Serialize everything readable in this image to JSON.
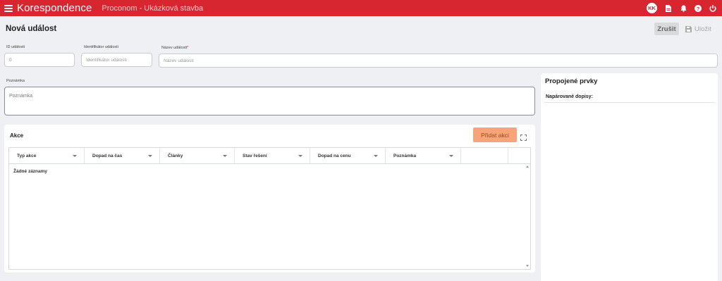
{
  "app": {
    "title": "Korespondence",
    "project": "Proconom - Ukázková stavba",
    "avatar_initials": "KK",
    "accent_color": "#d7262f",
    "icons": [
      "menu-icon",
      "document-icon",
      "bell-icon",
      "help-icon",
      "logout-icon"
    ]
  },
  "page": {
    "title": "Nová událost",
    "cancel_label": "Zrušit",
    "save_label": "Uložit"
  },
  "form": {
    "id_label": "ID události",
    "id_value": "0",
    "identifier_label": "Identifikátor události",
    "identifier_placeholder": "Identifikátor události",
    "name_label": "Název události",
    "name_placeholder": "Název události",
    "note_label": "Poznámka",
    "note_placeholder": "Poznámka"
  },
  "akce": {
    "title": "Akce",
    "add_label": "Přidat akci",
    "columns": [
      "Typ akce",
      "Dopad na čas",
      "Články",
      "Stav řešení",
      "Dopad na cenu",
      "Poznámka"
    ],
    "empty_text": "Žádné záznamy"
  },
  "related": {
    "title": "Propojené prvky",
    "paired_label": "Napárované dopisy:"
  }
}
